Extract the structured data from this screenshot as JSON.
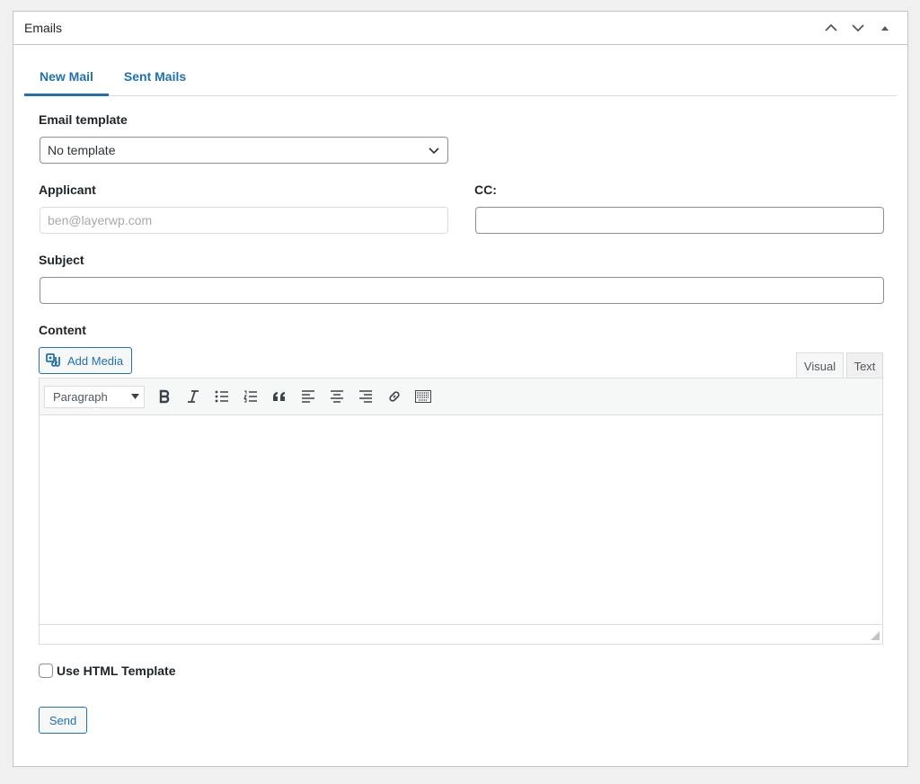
{
  "postbox": {
    "title": "Emails"
  },
  "tabs": [
    {
      "label": "New Mail",
      "active": true
    },
    {
      "label": "Sent Mails",
      "active": false
    }
  ],
  "form": {
    "template_label": "Email template",
    "template_selected": "No template",
    "applicant_label": "Applicant",
    "applicant_value": "ben@layerwp.com",
    "cc_label": "CC:",
    "cc_value": "",
    "subject_label": "Subject",
    "subject_value": "",
    "content_label": "Content"
  },
  "editor": {
    "add_media_label": "Add Media",
    "visual_tab": "Visual",
    "text_tab": "Text",
    "format_selected": "Paragraph",
    "toolbar_icons": [
      "bold-icon",
      "italic-icon",
      "bulleted-list-icon",
      "numbered-list-icon",
      "blockquote-icon",
      "align-left-icon",
      "align-center-icon",
      "align-right-icon",
      "link-icon",
      "toolbar-toggle-icon"
    ]
  },
  "options": {
    "html_template_label": "Use HTML Template",
    "html_template_checked": false
  },
  "actions": {
    "send_label": "Send"
  },
  "colors": {
    "accent": "#2271b1",
    "border": "#8c8f94",
    "background": "#f0f0f1"
  }
}
